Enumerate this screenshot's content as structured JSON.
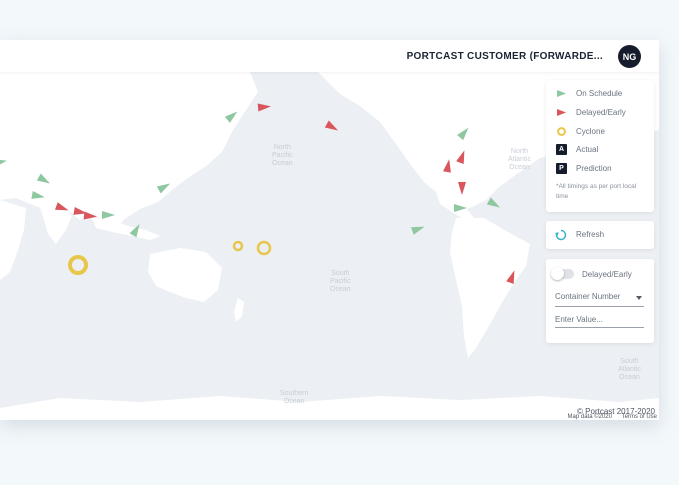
{
  "header": {
    "customer_name": "PORTCAST CUSTOMER (FORWARDE...",
    "avatar_initials": "NG"
  },
  "legend": {
    "items": [
      {
        "label": "On Schedule",
        "icon": "green-ship-icon",
        "color": "#8fc7a0"
      },
      {
        "label": "Delayed/Early",
        "icon": "red-ship-icon",
        "color": "#d9575c"
      },
      {
        "label": "Cyclone",
        "icon": "cyclone-icon",
        "color": "#e8c64a"
      },
      {
        "label": "Actual",
        "badge": "A"
      },
      {
        "label": "Prediction",
        "badge": "P"
      }
    ],
    "note": "*All timings as per port local time"
  },
  "refresh": {
    "label": "Refresh",
    "icon": "refresh-icon"
  },
  "filters": {
    "toggle_label": "Delayed/Early",
    "container_select": "Container Number",
    "value_placeholder": "Enter Value..."
  },
  "map": {
    "ocean_labels": [
      {
        "text": "North\nPacific\nOcean"
      },
      {
        "text": "North\nAtlantic\nOcean"
      },
      {
        "text": "South\nPacific\nOcean"
      },
      {
        "text": "South\nAtlantic\nOcean"
      },
      {
        "text": "Southern\nOcean"
      }
    ],
    "attribution": {
      "copyright": "© Portcast 2017-2020",
      "map_data": "Map data ©2020",
      "terms": "Terms of Use"
    }
  },
  "colors": {
    "on_schedule": "#8fc7a0",
    "delayed": "#d9575c",
    "cyclone": "#e8c64a",
    "dark": "#151c2c"
  }
}
